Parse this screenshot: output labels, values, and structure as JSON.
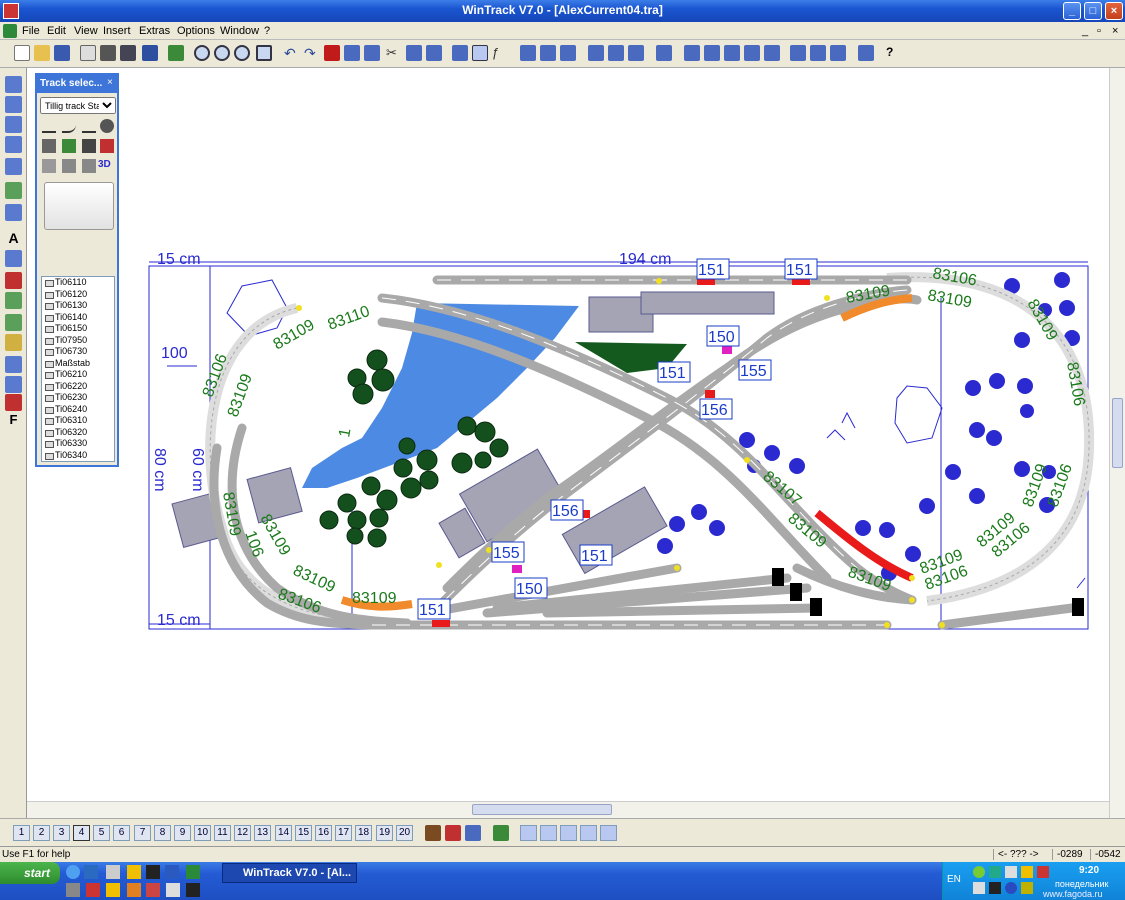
{
  "window": {
    "title": "WinTrack  V7.0 - [AlexCurrent04.tra]",
    "min": "_",
    "max": "□",
    "close": "×",
    "doc_min": "_",
    "doc_restore": "▫",
    "doc_close": "×"
  },
  "menu": [
    "File",
    "Edit",
    "View",
    "Insert",
    "Extras",
    "Options",
    "Window",
    "?"
  ],
  "track_panel": {
    "title": "Track selec...",
    "close": "×",
    "dropdown_value": "Tillig track Sta",
    "tool_3d": "3D",
    "items": [
      "Ti06110",
      "Ti06120",
      "Ti06130",
      "Ti06140",
      "Ti06150",
      "Ti07950",
      "Ti06730",
      "Maßstab",
      "Ti06210",
      "Ti06220",
      "Ti06230",
      "Ti06240",
      "Ti06310",
      "Ti06320",
      "Ti06330",
      "Ti06340"
    ]
  },
  "dimensions": {
    "top_left": "15 cm",
    "top": "194 cm",
    "side_100": "100",
    "height": "80 cm",
    "inner": "60 cm",
    "bottom_left": "15 cm"
  },
  "track_labels": {
    "n151": "151",
    "n150": "150",
    "n155": "155",
    "n156": "156",
    "n83106": "83106",
    "n83109": "83109",
    "n83110": "83110",
    "n83107": "83107",
    "n106": "106",
    "n1a": "1",
    "n83109x": "83109"
  },
  "pages": [
    "1",
    "2",
    "3",
    "4",
    "5",
    "6",
    "7",
    "8",
    "9",
    "10",
    "11",
    "12",
    "13",
    "14",
    "15",
    "16",
    "17",
    "18",
    "19",
    "20"
  ],
  "status": {
    "help": "Use F1 for help",
    "nav": "<- ??? ->",
    "x": "-0289",
    "y": "-0542"
  },
  "taskbar": {
    "start": "start",
    "task": "WinTrack  V7.0 - [Al...",
    "lang": "EN",
    "time": "9:20",
    "day": "понедельник",
    "watermark": "www.fagoda.ru"
  },
  "colors": {
    "titlebar": "#1a55d0",
    "track": "#a9a9a9",
    "label_green": "#1a7a1a",
    "label_blue": "#1a3cc8",
    "water": "#3a7de0",
    "tree": "#14501e",
    "red": "#e81a1a",
    "orange": "#f08a2a"
  }
}
